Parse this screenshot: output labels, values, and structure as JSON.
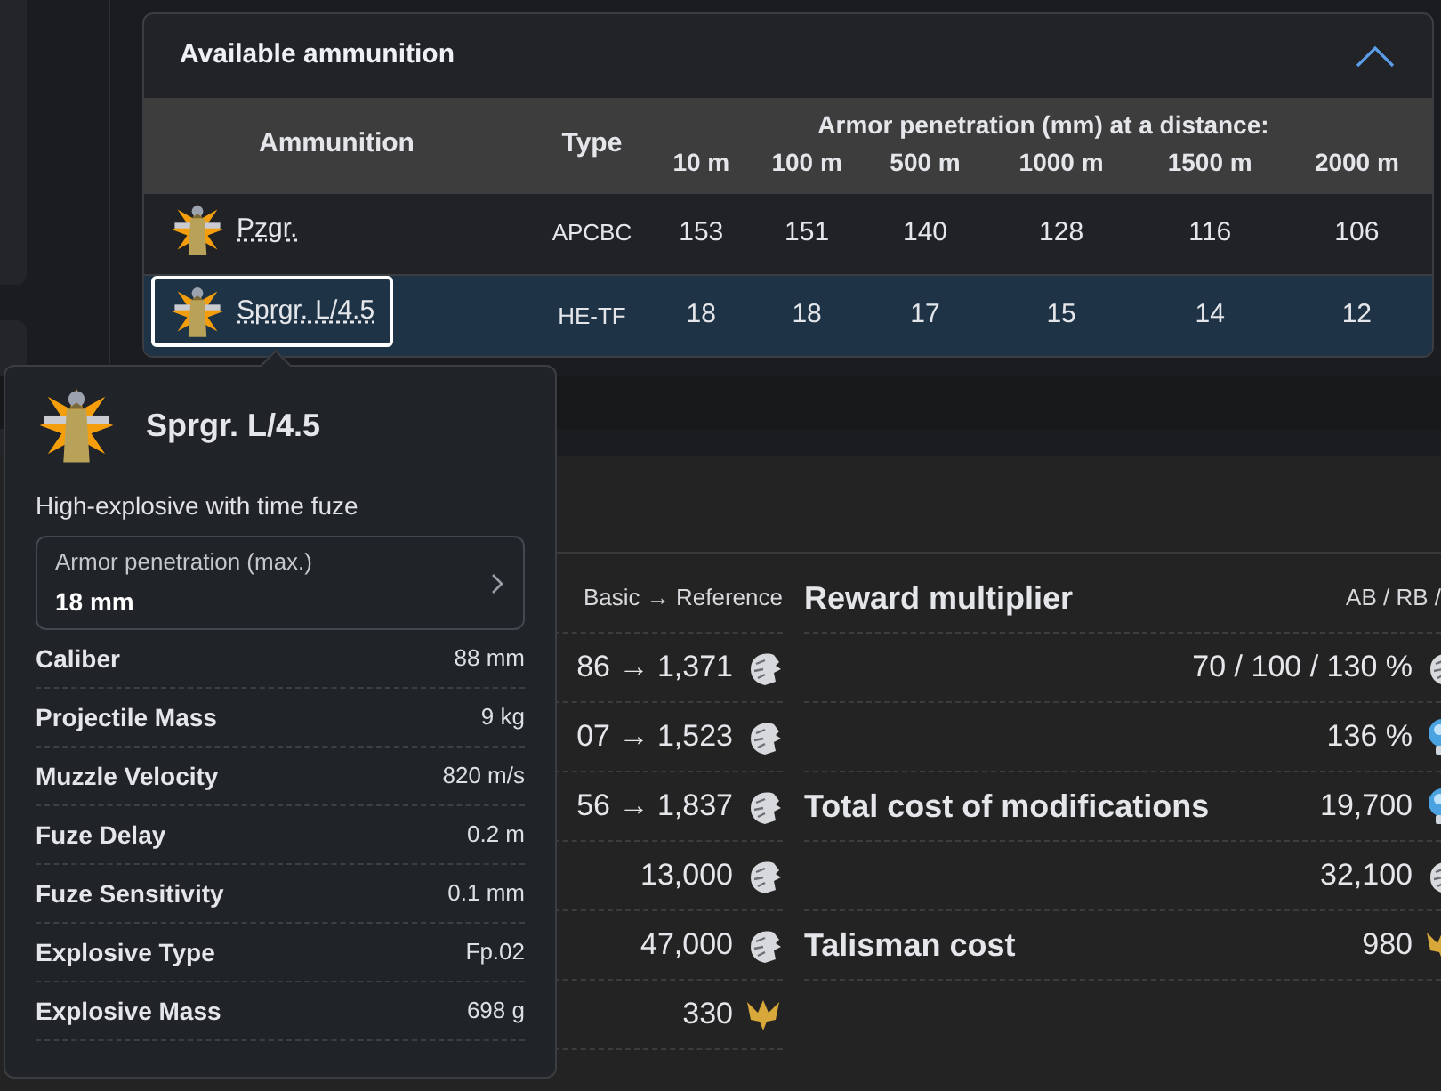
{
  "ammo_panel": {
    "title": "Available ammunition",
    "expanded": true,
    "columns": {
      "ammunition": "Ammunition",
      "type": "Type",
      "penetration_group": "Armor penetration (mm) at a distance:",
      "distances": [
        "10 m",
        "100 m",
        "500 m",
        "1000 m",
        "1500 m",
        "2000 m"
      ]
    },
    "rows": [
      {
        "name": "Pzgr.",
        "type": "APCBC",
        "values": [
          "153",
          "151",
          "140",
          "128",
          "116",
          "106"
        ],
        "selected": false
      },
      {
        "name": "Sprgr. L/4.5",
        "type": "HE-TF",
        "values": [
          "18",
          "18",
          "17",
          "15",
          "14",
          "12"
        ],
        "selected": true
      }
    ]
  },
  "tooltip": {
    "name": "Sprgr. L/4.5",
    "description": "High-explosive with time fuze",
    "penetration": {
      "label": "Armor penetration (max.)",
      "value": "18 mm"
    },
    "stats": [
      {
        "label": "Caliber",
        "value": "88 mm"
      },
      {
        "label": "Projectile Mass",
        "value": "9 kg"
      },
      {
        "label": "Muzzle Velocity",
        "value": "820 m/s"
      },
      {
        "label": "Fuze Delay",
        "value": "0.2 m"
      },
      {
        "label": "Fuze Sensitivity",
        "value": "0.1 mm"
      },
      {
        "label": "Explosive Type",
        "value": "Fp.02"
      },
      {
        "label": "Explosive Mass",
        "value": "698 g"
      }
    ]
  },
  "economy_left": {
    "header": "Basic → Reference",
    "rows": [
      {
        "value": "86 → 1,371",
        "kind": "silver"
      },
      {
        "value": "07 → 1,523",
        "kind": "silver"
      },
      {
        "value": "56 → 1,837",
        "kind": "silver"
      },
      {
        "value": "13,000",
        "kind": "silver"
      },
      {
        "value": "47,000",
        "kind": "silver"
      },
      {
        "value": "330",
        "kind": "gold"
      }
    ]
  },
  "economy_right": {
    "title": "Reward multiplier",
    "modes": "AB / RB /",
    "rows": [
      {
        "value": "70 / 100 / 130 %",
        "kind": "silver"
      },
      {
        "value": "136 %",
        "kind": "research"
      },
      {
        "label": "Total cost of modifications",
        "value": "19,700",
        "kind": "research"
      },
      {
        "value": "32,100",
        "kind": "silver"
      },
      {
        "label": "Talisman cost",
        "value": "980",
        "kind": "gold"
      }
    ]
  }
}
